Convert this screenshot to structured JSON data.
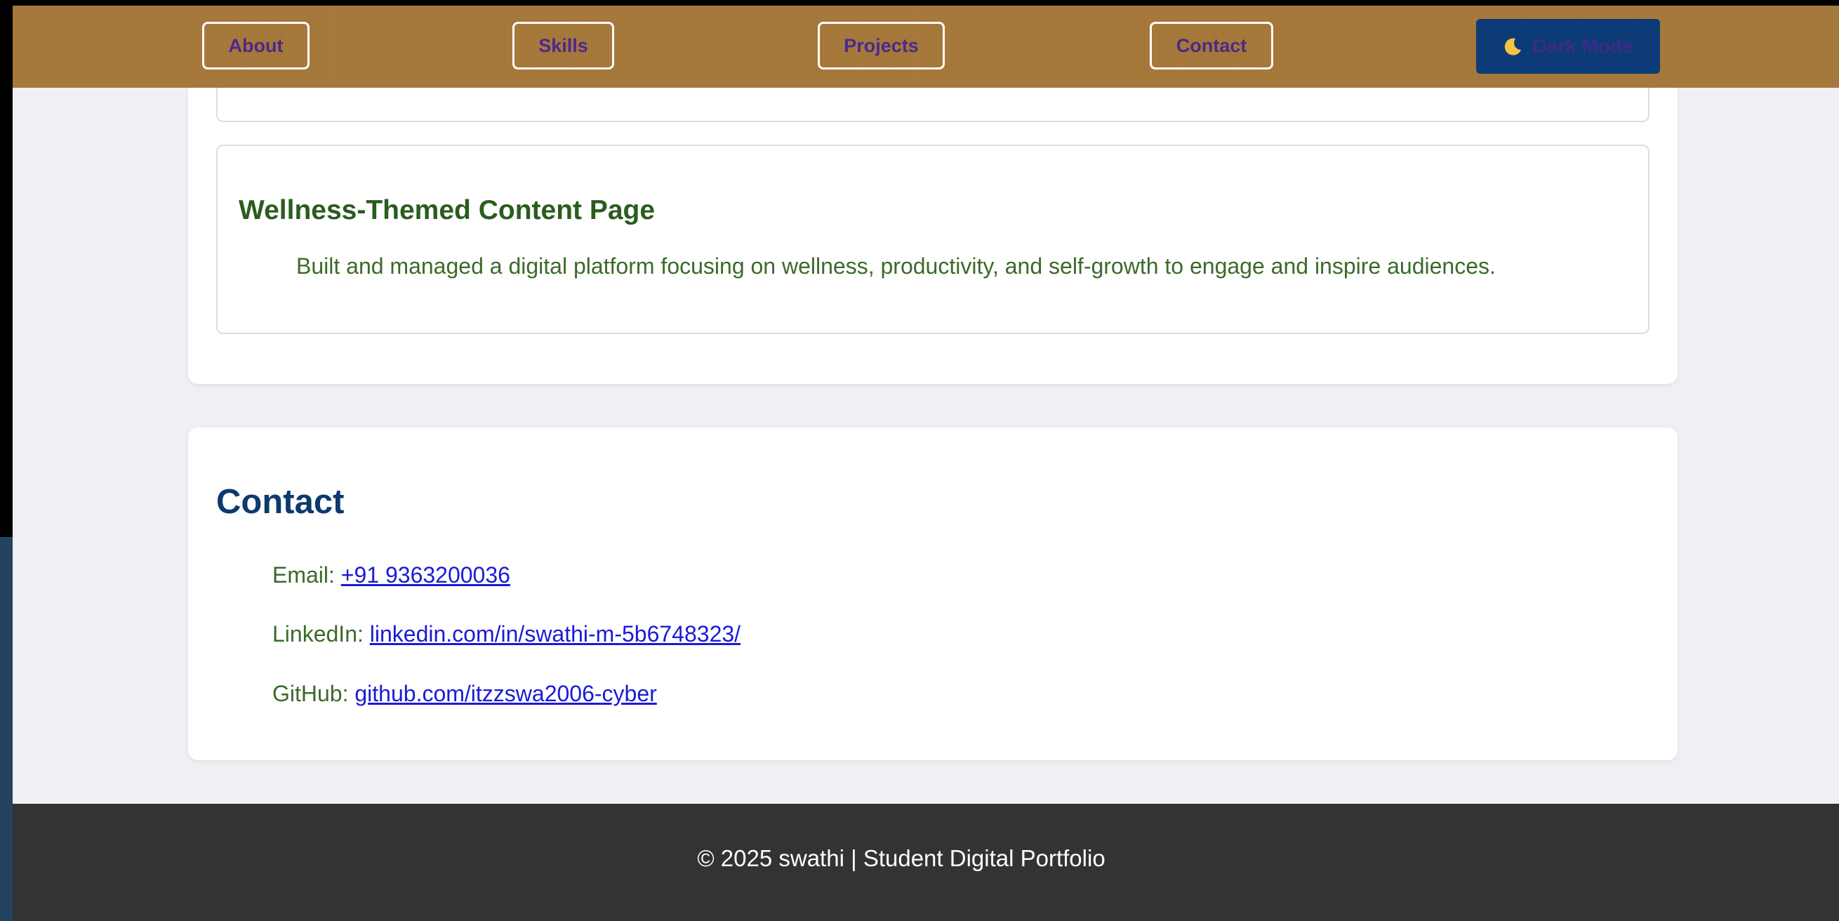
{
  "nav": {
    "items": [
      {
        "label": "About"
      },
      {
        "label": "Skills"
      },
      {
        "label": "Projects"
      },
      {
        "label": "Contact"
      }
    ],
    "dark_mode_label": "Dark Mode",
    "dark_mode_icon": "moon-icon"
  },
  "projects": {
    "items": [
      {
        "title": "Wellness-Themed Content Page",
        "description": "Built and managed a digital platform focusing on wellness, productivity, and self-growth to engage and inspire audiences."
      }
    ]
  },
  "contact": {
    "title": "Contact",
    "email_label": "Email: ",
    "email_value": "+91 9363200036",
    "linkedin_label": "LinkedIn: ",
    "linkedin_value": "linkedin.com/in/swathi-m-5b6748323/",
    "github_label": "GitHub: ",
    "github_value": "github.com/itzzswa2006-cyber"
  },
  "footer": {
    "text": "© 2025 swathi | Student Digital Portfolio"
  },
  "colors": {
    "nav_background": "#a67839",
    "nav_text": "#4b2a8a",
    "dark_button": "#0c3b78",
    "heading_blue": "#0d3a6e",
    "text_green": "#3c6a2a",
    "link_blue": "#1a1ad8",
    "footer_background": "#333333"
  }
}
